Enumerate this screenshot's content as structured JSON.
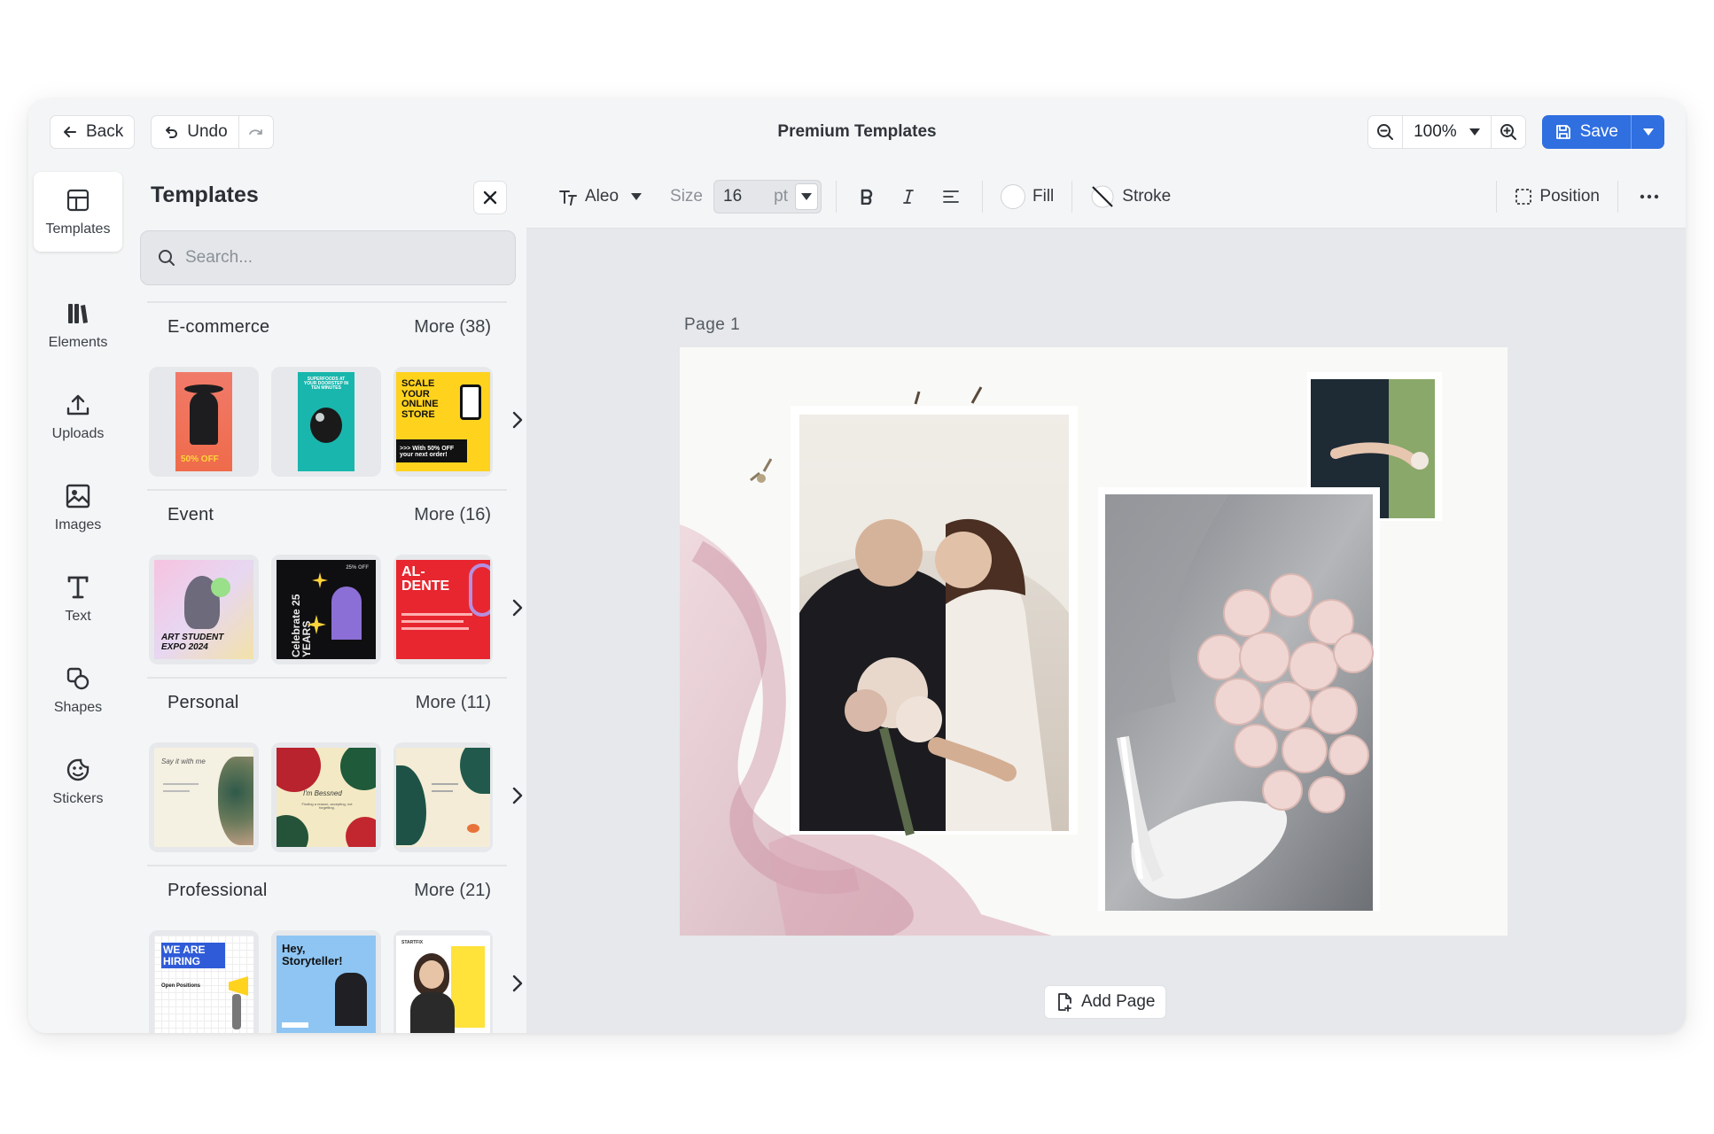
{
  "header": {
    "back_label": "Back",
    "undo_label": "Undo",
    "title": "Premium Templates",
    "zoom_value": "100%",
    "save_label": "Save"
  },
  "rail": {
    "items": [
      {
        "label": "Templates",
        "icon": "layout-icon"
      },
      {
        "label": "Elements",
        "icon": "library-icon"
      },
      {
        "label": "Uploads",
        "icon": "upload-icon"
      },
      {
        "label": "Images",
        "icon": "image-icon"
      },
      {
        "label": "Text",
        "icon": "text-icon"
      },
      {
        "label": "Shapes",
        "icon": "shapes-icon"
      },
      {
        "label": "Stickers",
        "icon": "sticker-icon"
      }
    ]
  },
  "panel": {
    "title": "Templates",
    "search_placeholder": "Search...",
    "categories": [
      {
        "name": "E-commerce",
        "more": "More (38)",
        "thumbs": [
          {
            "text": "50% OFF"
          },
          {
            "text": "SUPERFOODS AT YOUR DOORSTEP IN TEN MINUTES"
          },
          {
            "text": "SCALE YOUR ONLINE STORE",
            "sub": ">>> With 50% OFF your next order!"
          }
        ]
      },
      {
        "name": "Event",
        "more": "More (16)",
        "thumbs": [
          {
            "text": "ART STUDENT EXPO 2024"
          },
          {
            "text": "Celebrate 25 YEARS",
            "sub": "25% OFF"
          },
          {
            "text": "AL- DENTE"
          }
        ]
      },
      {
        "name": "Personal",
        "more": "More (11)",
        "thumbs": [
          {
            "text": "Say it with me"
          },
          {
            "text": "I'm Bessned",
            "sub": "Finding a reason, accepting, not forgetting."
          },
          {
            "text": ""
          }
        ]
      },
      {
        "name": "Professional",
        "more": "More (21)",
        "thumbs": [
          {
            "text": "WE ARE HIRING",
            "sub": "Open Positions"
          },
          {
            "text": "Hey, Storyteller!"
          },
          {
            "text": "STARTFIX"
          }
        ]
      }
    ]
  },
  "toolbar": {
    "font": "Aleo",
    "size_label": "Size",
    "size_value": "16",
    "size_unit": "pt",
    "fill_label": "Fill",
    "stroke_label": "Stroke",
    "position_label": "Position"
  },
  "canvas": {
    "page_label": "Page  1",
    "add_page_label": "Add Page"
  },
  "colors": {
    "accent": "#2f6fe0",
    "panel_bg": "#f4f5f6",
    "canvas_bg": "#e6e8eb"
  }
}
